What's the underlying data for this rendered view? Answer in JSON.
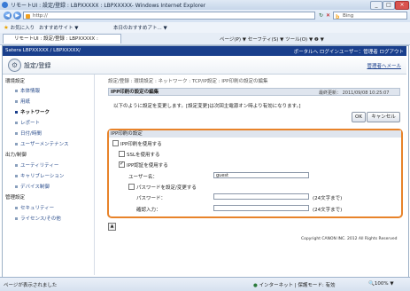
{
  "window": {
    "title": "リモートUI : 設定/登録 : LBPXXXXX : LBPXXXXX- Windows Internet Explorer",
    "controls": [
      "_",
      "□",
      "×"
    ]
  },
  "browser": {
    "address": "http://",
    "search_placeholder": "Bing",
    "favorites_label": "お気に入り",
    "suggested_sites": "おすすめサイト ▼",
    "today_topics": "本日のおすすめアト... ▼",
    "tab_label": "リモートUI : 設定/登録 : LBPXXXXX : LBPXXX...",
    "menu_right": "ページ(P) ▼  セーフティ(S) ▼  ツール(O) ▼  ❷ ▼"
  },
  "header": {
    "brand": "Satera",
    "model": "LBPXXXXX / LBPXXXXX/",
    "links": "ポータルへ  ログインユーザー：管理者  ログアウト",
    "page_title": "設定/登録",
    "help_link": "管理者へメール"
  },
  "sidebar": {
    "sections": [
      {
        "heading": "環境設定",
        "items": [
          "本体情報",
          "用紙",
          "ネットワーク",
          "レポート",
          "日付/時間",
          "ユーザーメンテナンス"
        ]
      },
      {
        "heading": "出力/制御",
        "items": [
          "ユーティリティー",
          "キャリブレーション",
          "デバイス制御"
        ]
      },
      {
        "heading": "管理設定",
        "items": [
          "セキュリティー",
          "ライセンス/その他"
        ]
      }
    ],
    "active_item": "ネットワーク"
  },
  "main": {
    "breadcrumb": "設定/登録 : 環境設定 : ネットワーク : TCP/IP設定 : IPP印刷の設定の編集",
    "section_title": "IPP印刷の設定の編集",
    "last_updated": "最終更新：  2011/09/08 10:25:07",
    "message": "以下のように設定を変更します。[設定変更]は次回主電源オン時より有効になります。]",
    "ok_label": "OK",
    "cancel_label": "キャンセル",
    "settings_header": "IPP印刷の設定",
    "use_ipp": "IPP印刷を使用する",
    "use_ssl": "SSLを使用する",
    "use_auth": "IPP認証を使用する",
    "username_label": "ユーザー名：",
    "username_value": "guest",
    "set_password": "パスワードを設定/変更する",
    "password_label": "パスワード：",
    "password_hint": "(24文字まで)",
    "confirm_label": "確認入力：",
    "confirm_hint": "(24文字まで)",
    "copyright": "Copyright CANON INC. 2012 All Rights Reserved"
  },
  "statusbar": {
    "left": "ページが表示されました",
    "zone": "インターネット | 保護モード: 有効",
    "zoom": "100%"
  }
}
